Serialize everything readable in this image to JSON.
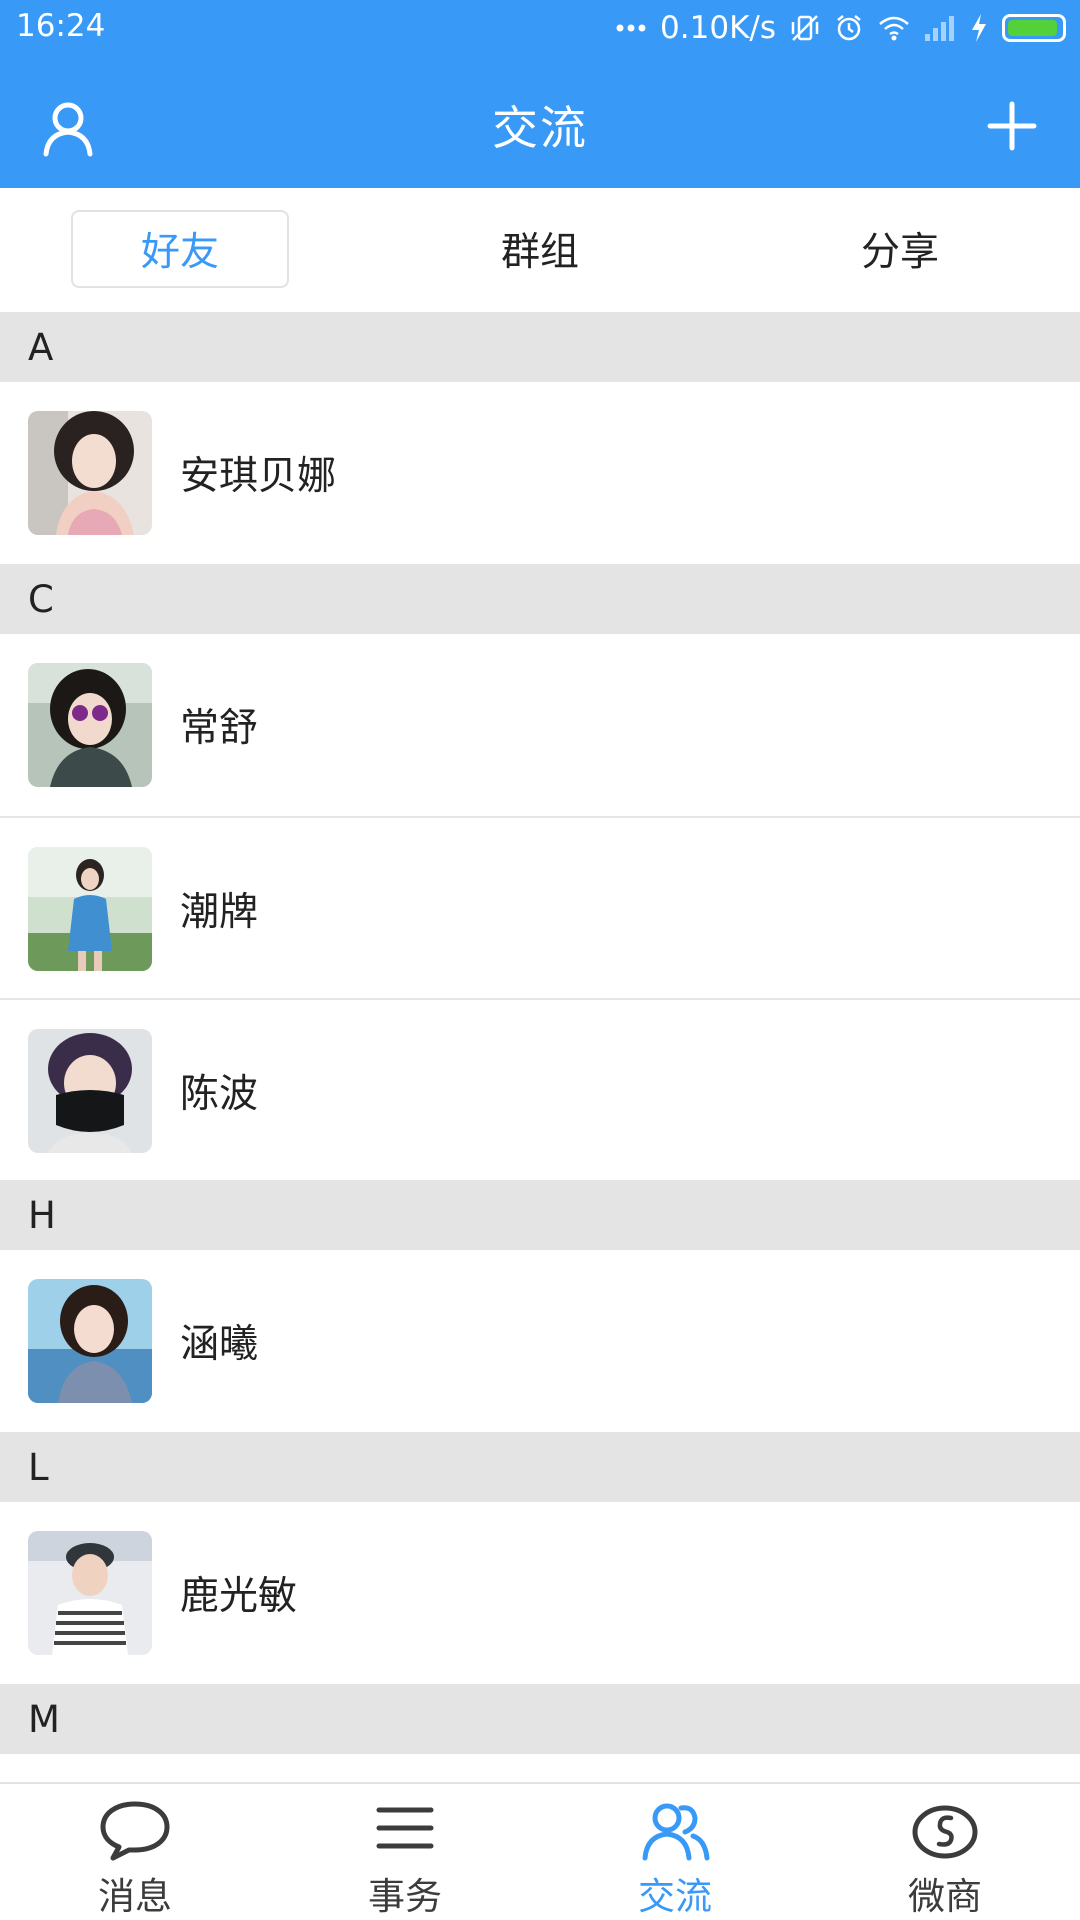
{
  "status_bar": {
    "time": "16:24",
    "network_speed": "0.10K/s",
    "icons": [
      "dots-icon",
      "vibrate-off-icon",
      "alarm-icon",
      "wifi-icon",
      "signal-icon",
      "charging-icon",
      "battery-icon"
    ],
    "battery_level": 0.95,
    "battery_color": "#52d13a"
  },
  "header": {
    "title": "交流",
    "left_icon": "user-icon",
    "right_icon": "plus-icon",
    "background": "#3899f7"
  },
  "tabs": [
    {
      "label": "好友",
      "active": true
    },
    {
      "label": "群组",
      "active": false
    },
    {
      "label": "分享",
      "active": false
    }
  ],
  "sections": [
    {
      "letter": "A",
      "contacts": [
        {
          "name": "安琪贝娜"
        }
      ]
    },
    {
      "letter": "C",
      "contacts": [
        {
          "name": "常舒"
        },
        {
          "name": "潮牌"
        },
        {
          "name": "陈波"
        }
      ]
    },
    {
      "letter": "H",
      "contacts": [
        {
          "name": "涵曦"
        }
      ]
    },
    {
      "letter": "L",
      "contacts": [
        {
          "name": "鹿光敏"
        }
      ]
    },
    {
      "letter": "M",
      "contacts": []
    }
  ],
  "bottom_nav": [
    {
      "label": "消息",
      "icon": "chat-bubble-icon",
      "active": false
    },
    {
      "label": "事务",
      "icon": "menu-lines-icon",
      "active": false
    },
    {
      "label": "交流",
      "icon": "contacts-icon",
      "active": true
    },
    {
      "label": "微商",
      "icon": "money-bag-icon",
      "active": false
    }
  ],
  "colors": {
    "accent": "#3899f7",
    "section_bg": "#e4e4e4",
    "text": "#222222"
  }
}
